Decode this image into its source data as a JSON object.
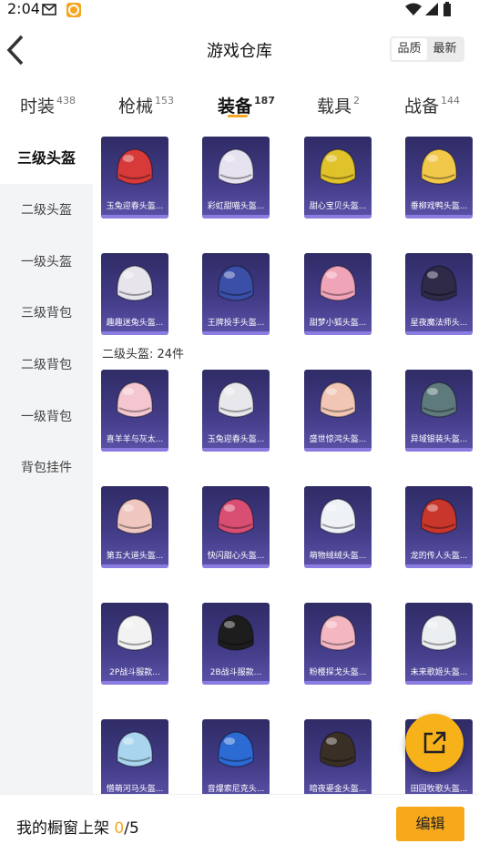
{
  "status_bar": {
    "time": "2:04"
  },
  "header": {
    "title": "游戏仓库",
    "sort_quality": "品质",
    "sort_newest": "最新"
  },
  "tabs": [
    {
      "label": "时装",
      "count": "438"
    },
    {
      "label": "枪械",
      "count": "153"
    },
    {
      "label": "装备",
      "count": "187"
    },
    {
      "label": "载具",
      "count": "2"
    },
    {
      "label": "战备",
      "count": "144"
    }
  ],
  "sidebar": {
    "items": [
      "三级头盔",
      "二级头盔",
      "一级头盔",
      "三级背包",
      "二级背包",
      "一级背包",
      "背包挂件"
    ]
  },
  "section_label": "二级头盔: 24件",
  "items": [
    {
      "name": "玉兔迎春头盔...",
      "color": "#d83a3a"
    },
    {
      "name": "彩虹甜喵头盔...",
      "color": "#e6e2ef"
    },
    {
      "name": "甜心宝贝头盔...",
      "color": "#e0c22a"
    },
    {
      "name": "垂柳戏鸭头盔...",
      "color": "#f2c84b"
    },
    {
      "name": "趣趣迷兔头盔...",
      "color": "#e8e4ec"
    },
    {
      "name": "王牌投手头盔...",
      "color": "#3b4fa8"
    },
    {
      "name": "甜梦小狐头盔...",
      "color": "#f0a4b8"
    },
    {
      "name": "星夜魔法师头...",
      "color": "#2e2a48"
    },
    {
      "name": "喜羊羊与灰太...",
      "color": "#f4c6d0"
    },
    {
      "name": "玉兔迎春头盔...",
      "color": "#e8e8ec"
    },
    {
      "name": "盛世惊鸿头盔...",
      "color": "#f1c6b4"
    },
    {
      "name": "异域银装头盔...",
      "color": "#5e7a7c"
    },
    {
      "name": "第五大道头盔...",
      "color": "#f0c6c0"
    },
    {
      "name": "快闪甜心头盔...",
      "color": "#d84f73"
    },
    {
      "name": "萌物绒绒头盔...",
      "color": "#eef1f5"
    },
    {
      "name": "龙的传人头盔...",
      "color": "#c8362c"
    },
    {
      "name": "2P战斗服款...",
      "color": "#f2f2f2"
    },
    {
      "name": "2B战斗服款...",
      "color": "#1d1d1d"
    },
    {
      "name": "粉樱探戈头盔...",
      "color": "#f4b7c2"
    },
    {
      "name": "未来歌姬头盔...",
      "color": "#eceff2"
    },
    {
      "name": "憎萌河马头盔...",
      "color": "#a9d6ee"
    },
    {
      "name": "音爆索尼克头...",
      "color": "#2c6bd4"
    },
    {
      "name": "暗夜鎏金头盔...",
      "color": "#3a2f25"
    },
    {
      "name": "田园牧歌头盔...",
      "color": "#e9e4d8"
    }
  ],
  "bottom": {
    "label": "我的橱窗上架",
    "count": "0",
    "total": "/5",
    "edit": "编辑"
  }
}
